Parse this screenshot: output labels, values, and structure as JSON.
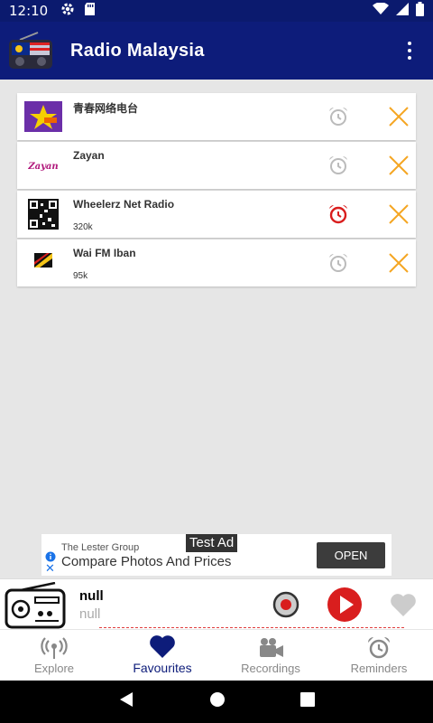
{
  "status_bar": {
    "time": "12:10"
  },
  "app_bar": {
    "title": "Radio Malaysia"
  },
  "favourites": [
    {
      "name": "青春网络电台",
      "bitrate": "",
      "alarm_active": false
    },
    {
      "name": "Zayan",
      "bitrate": "",
      "alarm_active": false
    },
    {
      "name": "Wheelerz Net Radio",
      "bitrate": "320k",
      "alarm_active": true
    },
    {
      "name": "Wai FM Iban",
      "bitrate": "95k",
      "alarm_active": false
    }
  ],
  "ad": {
    "test_label": "Test Ad",
    "advertiser": "The Lester Group",
    "headline": "Compare Photos And Prices",
    "cta": "OPEN"
  },
  "player": {
    "title": "null",
    "subtitle": "null"
  },
  "bottom_nav": {
    "items": [
      {
        "label": "Explore",
        "icon": "broadcast-icon",
        "active": false
      },
      {
        "label": "Favourites",
        "icon": "heart-icon",
        "active": true
      },
      {
        "label": "Recordings",
        "icon": "video-camera-icon",
        "active": false
      },
      {
        "label": "Reminders",
        "icon": "alarm-clock-icon",
        "active": false
      }
    ]
  },
  "colors": {
    "app_bar": "#0d1c7a",
    "status_bar": "#0b1a6e",
    "accent_red": "#d91e1e",
    "remove_orange": "#f5a623"
  }
}
